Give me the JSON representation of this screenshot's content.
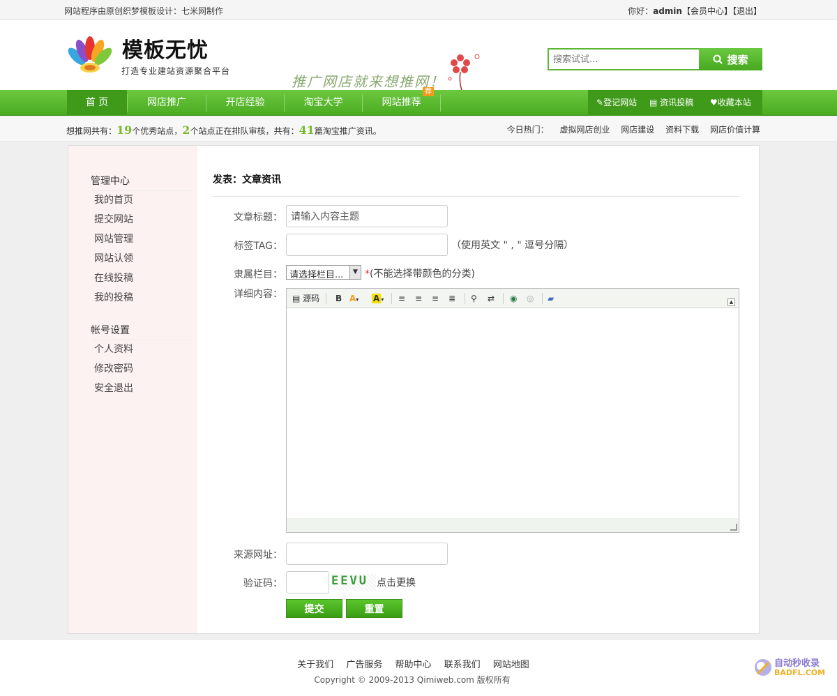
{
  "topbar": {
    "notice": "网站程序由原创织梦模板设计：七米网制作",
    "greeting": "你好：",
    "username": "admin",
    "member_center": "【会员中心】",
    "logout": "【退出】"
  },
  "header": {
    "brand": "模板无忧",
    "slogan": "打造专业建站资源聚合平台",
    "promo": "推广网店就来想推网！"
  },
  "search": {
    "placeholder": "搜索试试...",
    "button": "搜索"
  },
  "nav": {
    "items": [
      {
        "label": "首 页"
      },
      {
        "label": "网店推广"
      },
      {
        "label": "开店经验"
      },
      {
        "label": "淘宝大学"
      },
      {
        "label": "网站推荐"
      }
    ],
    "hot_badge": "荐",
    "right": [
      "登记网站",
      "资讯投稿",
      "收藏本站"
    ]
  },
  "stats": {
    "p1": "想推网共有：",
    "sites": "19",
    "p2": "个优秀站点，",
    "pending": "2",
    "p3": "个站点正在排队审核，共有：",
    "articles": "41",
    "p4": "篇淘宝推广资讯。",
    "hot_label": "今日热门：",
    "hot": [
      "虚拟网店创业",
      "网店建设",
      "资料下载",
      "网店价值计算"
    ]
  },
  "sidebar": {
    "group1": "管理中心",
    "items1": [
      "我的首页",
      "提交网站",
      "网站管理",
      "网站认领",
      "在线投稿",
      "我的投稿"
    ],
    "group2": "帐号设置",
    "items2": [
      "个人资料",
      "修改密码",
      "安全退出"
    ]
  },
  "form": {
    "heading": "发表：文章资讯",
    "title_label": "文章标题：",
    "title_value": "请输入内容主题",
    "tag_label": "标签TAG：",
    "tag_hint": "（使用英文 \" , \" 逗号分隔）",
    "category_label": "隶属栏目：",
    "category_value": "请选择栏目...",
    "category_required": "*",
    "category_hint": "(不能选择带颜色的分类)",
    "content_label": "详细内容：",
    "toolbar_source": "源码",
    "toolbar_bold": "B",
    "toolbar_font_color": "A",
    "toolbar_bg_color": "A",
    "source_label": "来源网址：",
    "captcha_label": "验证码：",
    "captcha_text": "EEVU",
    "captcha_refresh": "点击更换",
    "submit": "提交",
    "reset": "重置"
  },
  "footer": {
    "links": [
      "关于我们",
      "广告服务",
      "帮助中心",
      "联系我们",
      "网站地图"
    ],
    "copyright": "Copyright © 2009-2013 Qimiweb.com 版权所有"
  },
  "watermark": {
    "line1": "自动秒收录",
    "line2": "BADFL.COM"
  },
  "colors": {
    "brand_green": "#4aab21",
    "nav_active": "#3f9a19",
    "stat_number": "#7cb82f",
    "hot_badge": "#f39c1c",
    "sidebar_bg": "#fdf2f2"
  }
}
